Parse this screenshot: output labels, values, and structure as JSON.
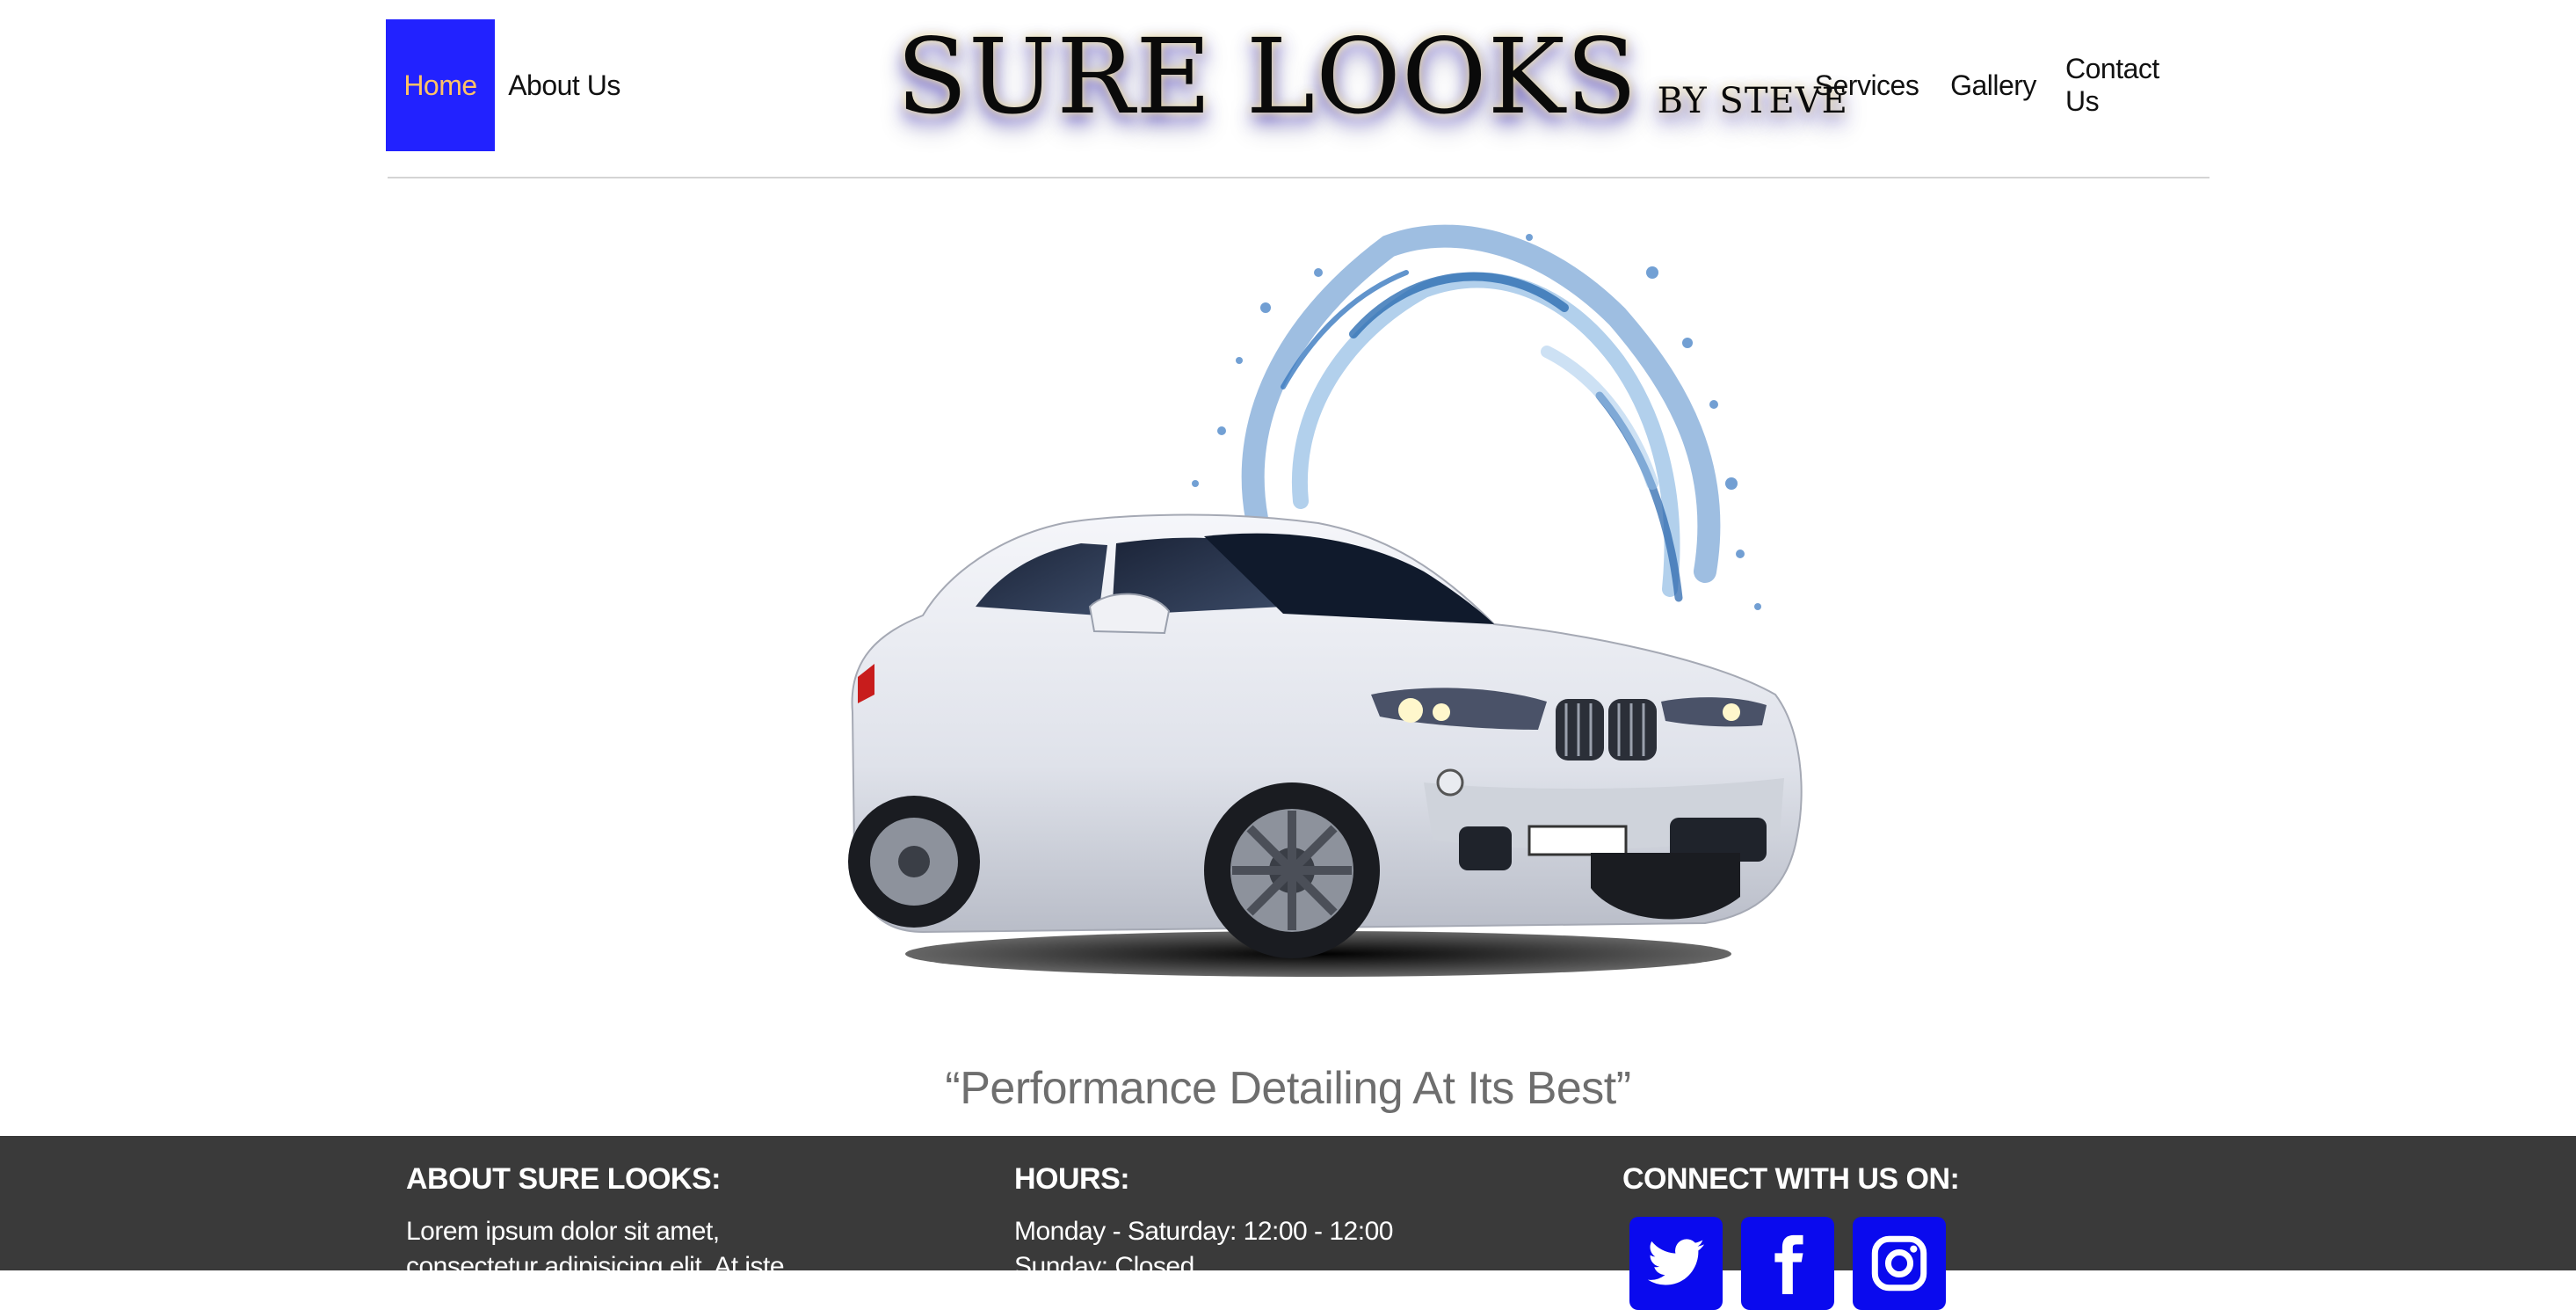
{
  "nav": {
    "left": [
      {
        "label": "Home",
        "active": true
      },
      {
        "label": "About Us"
      }
    ],
    "right": [
      {
        "label": "Services"
      },
      {
        "label": "Gallery"
      },
      {
        "label": "Contact Us"
      }
    ]
  },
  "brand": {
    "main": "SURE LOOKS",
    "sub": "BY STEVE"
  },
  "hero": {
    "image": "white-suv-with-water-splash"
  },
  "tagline": "“Performance Detailing At Its Best”",
  "footer": {
    "about": {
      "heading": "ABOUT SURE LOOKS:",
      "line1": "Lorem ipsum dolor sit amet,",
      "line2": "consectetur adipisicing elit. At iste"
    },
    "hours": {
      "heading": "HOURS:",
      "line1": "Monday - Saturday: 12:00 - 12:00",
      "line2": "Sunday: Closed"
    },
    "connect": {
      "heading": "CONNECT WITH US ON:",
      "icons": [
        "twitter-icon",
        "facebook-icon",
        "instagram-icon"
      ]
    }
  },
  "colors": {
    "nav_active_bg": "#2222ff",
    "nav_active_text": "#ffc266",
    "footer_bg": "#3a3a3a",
    "social_bg": "#0a0aee",
    "tagline": "#6e6e6e"
  }
}
